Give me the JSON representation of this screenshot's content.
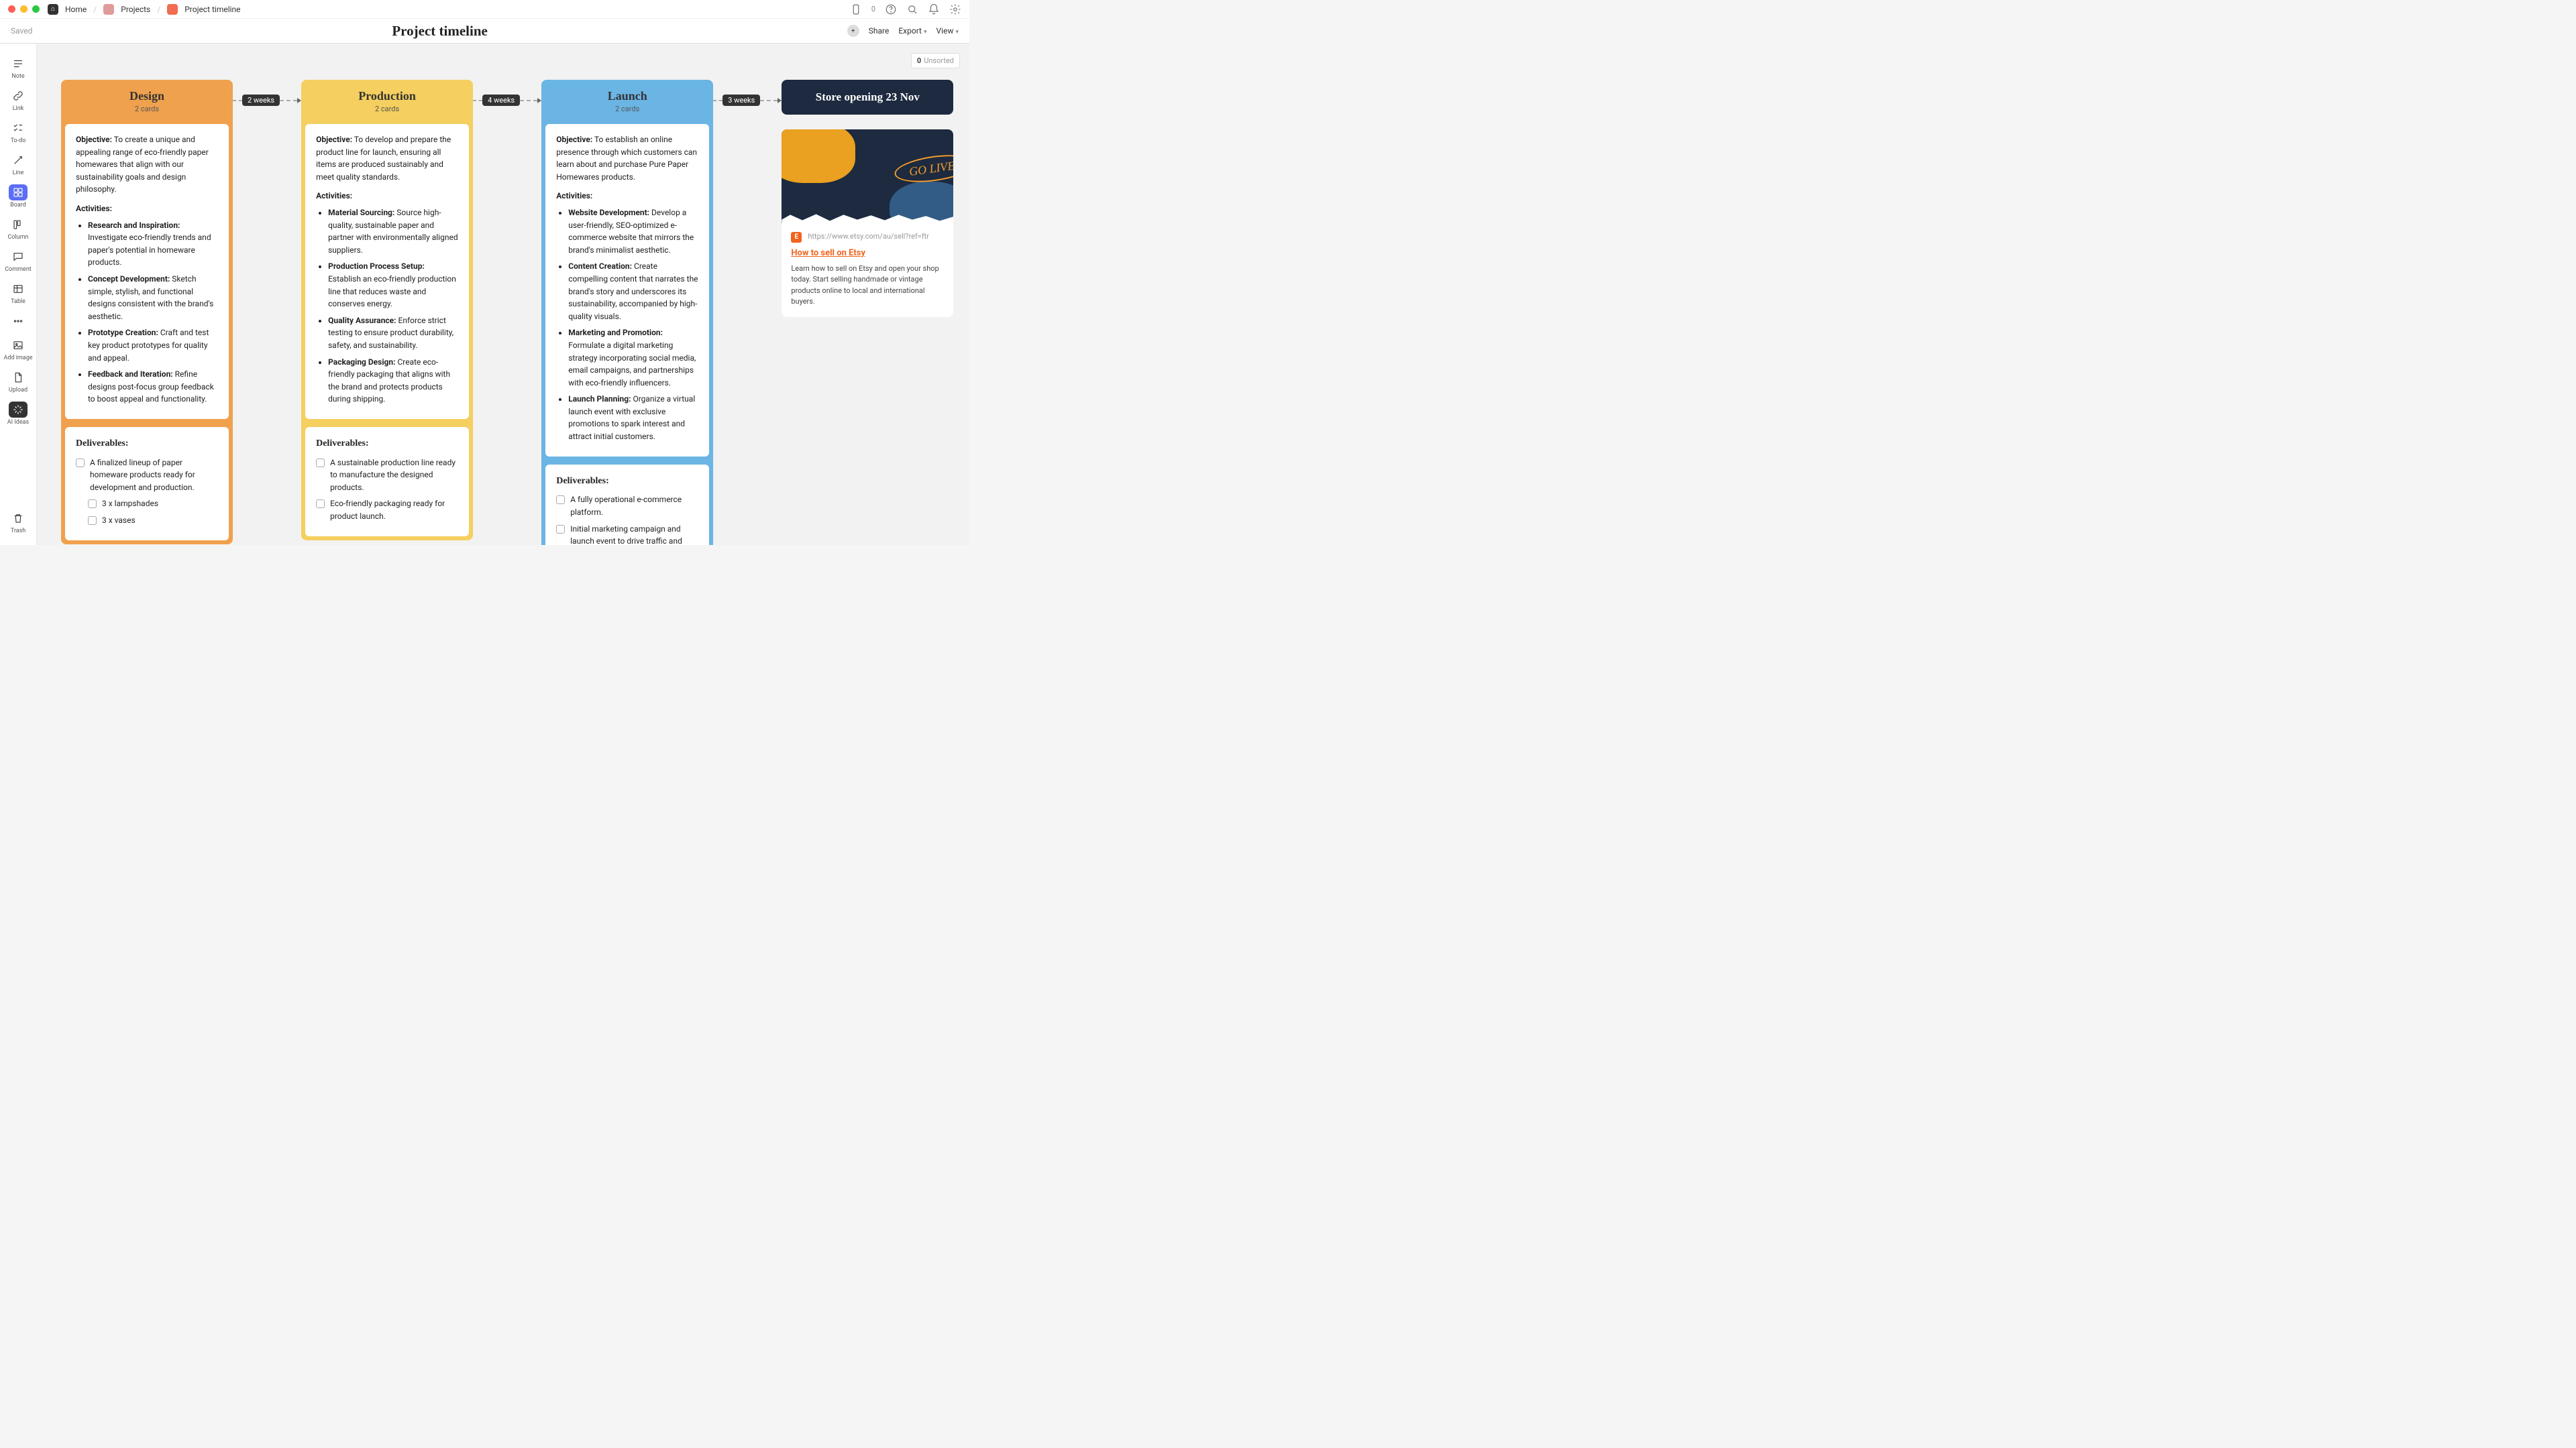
{
  "window": {
    "breadcrumbs": {
      "home": "Home",
      "projects": "Projects",
      "current": "Project timeline"
    },
    "pill_count": "0"
  },
  "secondbar": {
    "saved": "Saved",
    "title": "Project timeline",
    "share": "Share",
    "export": "Export",
    "view": "View"
  },
  "sidebar": {
    "note": "Note",
    "link": "Link",
    "todo": "To-do",
    "line": "Line",
    "board": "Board",
    "column": "Column",
    "comment": "Comment",
    "table": "Table",
    "addimage": "Add image",
    "upload": "Upload",
    "ai": "AI Ideas",
    "trash": "Trash"
  },
  "unsorted": {
    "count": "0",
    "label": "Unsorted"
  },
  "connectors": {
    "0": "2 weeks",
    "1": "4 weeks",
    "2": "3 weeks"
  },
  "columns": [
    {
      "title": "Design",
      "sub": "2 cards",
      "objective_label": "Objective:",
      "objective": " To create a unique and appealing range of eco-friendly paper homewares that align with our sustainability goals and design philosophy.",
      "activities_label": "Activities:",
      "acts": [
        {
          "k": "Research and Inspiration:",
          "v": " Investigate eco-friendly trends and paper's potential in homeware products."
        },
        {
          "k": "Concept Development:",
          "v": " Sketch simple, stylish, and functional designs consistent with the brand's aesthetic."
        },
        {
          "k": "Prototype Creation:",
          "v": " Craft and test key product prototypes for quality and appeal."
        },
        {
          "k": "Feedback and Iteration:",
          "v": " Refine designs post-focus group feedback to boost appeal and functionality."
        }
      ],
      "deliv_title": "Deliverables:",
      "delivs": [
        "A finalized lineup of paper homeware products ready for development and production.",
        "3 x lampshades",
        "3 x vases"
      ]
    },
    {
      "title": "Production",
      "sub": "2 cards",
      "objective_label": "Objective:",
      "objective": " To develop and prepare the product line for launch, ensuring all items are produced sustainably and meet quality standards.",
      "activities_label": "Activities:",
      "acts": [
        {
          "k": "Material Sourcing:",
          "v": " Source high-quality, sustainable paper and partner with environmentally aligned suppliers."
        },
        {
          "k": "Production Process Setup:",
          "v": " Establish an eco-friendly production line that reduces waste and conserves energy."
        },
        {
          "k": "Quality Assurance:",
          "v": " Enforce strict testing to ensure product durability, safety, and sustainability."
        },
        {
          "k": "Packaging Design:",
          "v": " Create eco-friendly packaging that aligns with the brand and protects products during shipping."
        }
      ],
      "deliv_title": "Deliverables:",
      "delivs": [
        "A sustainable production line ready to manufacture the designed products.",
        "Eco-friendly packaging ready for product launch."
      ]
    },
    {
      "title": "Launch",
      "sub": "2 cards",
      "objective_label": "Objective:",
      "objective": " To establish an online presence through which customers can learn about and purchase Pure Paper Homewares products.",
      "activities_label": "Activities:",
      "acts": [
        {
          "k": "Website Development:",
          "v": " Develop a user-friendly, SEO-optimized e-commerce website that mirrors the brand's minimalist aesthetic."
        },
        {
          "k": "Content Creation:",
          "v": " Create compelling content that narrates the brand's story and underscores its sustainability, accompanied by high-quality visuals."
        },
        {
          "k": "Marketing and Promotion:",
          "v": " Formulate a digital marketing strategy incorporating social media, email campaigns, and partnerships with eco-friendly influencers."
        },
        {
          "k": "Launch Planning:",
          "v": " Organize a virtual launch event with exclusive promotions to spark interest and attract initial customers."
        }
      ],
      "deliv_title": "Deliverables:",
      "delivs": [
        "A fully operational e-commerce platform.",
        "Initial marketing campaign and launch event to drive traffic and sales."
      ]
    }
  ],
  "darkcard": {
    "text": "Store opening 23 Nov"
  },
  "linkcard": {
    "go": "GO LIVE!",
    "url": "https://www.etsy.com/au/sell?ref=ftr",
    "title": "How to sell on Etsy",
    "desc": "Learn how to sell on Etsy and open your shop today. Start selling handmade or vintage products online to local and international buyers.",
    "etsy": "E"
  }
}
